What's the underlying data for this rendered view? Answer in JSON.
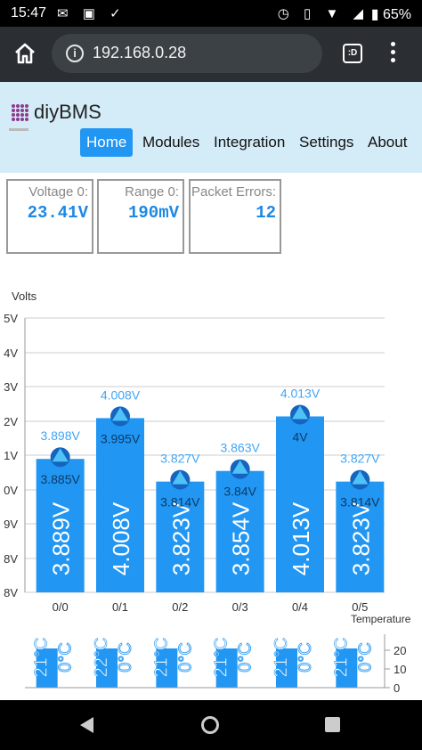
{
  "statusbar": {
    "time": "15:47",
    "battery": "65%"
  },
  "browser": {
    "url": "192.168.0.28",
    "tabs_label": ":D"
  },
  "app": {
    "title": "diyBMS"
  },
  "nav": {
    "items": [
      "Home",
      "Modules",
      "Integration",
      "Settings",
      "About"
    ],
    "active": "Home"
  },
  "tiles": [
    {
      "label": "Voltage 0:",
      "value": "23.41V"
    },
    {
      "label": "Range 0:",
      "value": "190mV"
    },
    {
      "label": "Packet Errors:",
      "value": "12"
    }
  ],
  "chart_data": {
    "type": "bar",
    "ylabel": "Volts",
    "y_tick_suffix": "5V",
    "categories": [
      "0/0",
      "0/1",
      "0/2",
      "0/3",
      "0/4",
      "0/5"
    ],
    "series": [
      {
        "values": [
          3.889,
          4.008,
          3.823,
          3.854,
          4.013,
          3.823
        ],
        "labels": [
          "3.889V",
          "4.008V",
          "3.823V",
          "3.854V",
          "4.013V",
          "3.823V"
        ]
      }
    ],
    "max_labels": [
      "3.898V",
      "4.008V",
      "3.827V",
      "3.863V",
      "4.013V",
      "3.827V"
    ],
    "min_labels": [
      "3.885V",
      "3.995V",
      "3.814V",
      "3.84V",
      "4V",
      "3.814V"
    ],
    "ylim": [
      3.5,
      4.3
    ],
    "y_axis_labels": [
      "5V",
      "4V",
      "3V",
      "2V",
      "1V",
      "0V",
      "9V",
      "8V"
    ],
    "temperature": {
      "axis_label": "Temperature",
      "external": [
        21,
        22,
        21,
        21,
        21,
        21
      ],
      "internal": [
        0,
        0,
        0,
        0,
        0,
        0
      ],
      "external_labels": [
        "21°C",
        "22°C",
        "21°C",
        "21°C",
        "21°C",
        "21°C"
      ],
      "internal_labels": [
        "0°C",
        "0°C",
        "0°C",
        "0°C",
        "0°C",
        "0°C"
      ],
      "y_ticks": [
        "20",
        "10",
        "0"
      ]
    }
  },
  "colors": {
    "bar": "#2196f3",
    "label": "#42a5f5",
    "grid": "#cccccc",
    "header_bg": "#d4ecf8"
  }
}
